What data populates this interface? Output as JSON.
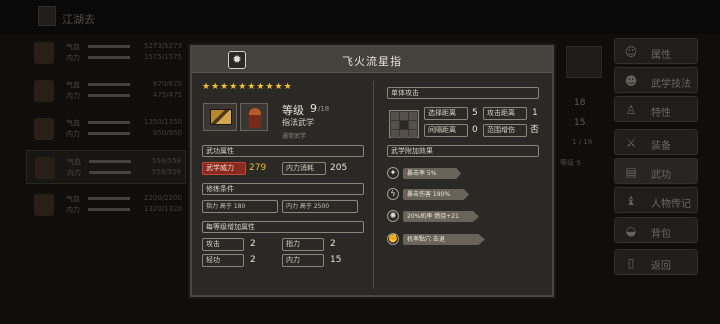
{
  "topbar": {
    "title": "江湖去"
  },
  "members": [
    {
      "label_hp": "气血",
      "label_mp": "内力",
      "hp": "5273/5273",
      "mp": "1575/1575"
    },
    {
      "label_hp": "气血",
      "label_mp": "内力",
      "hp": "670/670",
      "mp": "475/475"
    },
    {
      "label_hp": "气血",
      "label_mp": "内力",
      "hp": "1350/1350",
      "mp": "950/950"
    },
    {
      "label_hp": "气血",
      "label_mp": "内力",
      "hp": "558/558",
      "mp": "558/558"
    },
    {
      "label_hp": "气血",
      "label_mp": "内力",
      "hp": "2200/2200",
      "mp": "1320/1320"
    }
  ],
  "right_menu": [
    {
      "label": "属性",
      "icon": "person-icon"
    },
    {
      "label": "武学技法",
      "icon": "martial-icon"
    },
    {
      "label": "特性",
      "icon": "trait-icon"
    },
    {
      "label": "装备",
      "icon": "sword-icon"
    },
    {
      "label": "武功",
      "icon": "book-icon"
    },
    {
      "label": "人物传记",
      "icon": "biography-icon"
    },
    {
      "label": "背包",
      "icon": "bag-icon"
    },
    {
      "label": "返回",
      "icon": "return-icon"
    }
  ],
  "bg_panel": {
    "v1": "18",
    "v2": "15",
    "v3": "1 / 18",
    "level_text": "等级 9"
  },
  "modal": {
    "title": "飞火流星指",
    "icon": "flame-icon",
    "stars": "★★★★★★★★★★",
    "level_label": "等级",
    "level_value": "9",
    "level_max": "/18",
    "skill_type": "指法武学",
    "skill_sub": "通常武学",
    "sections": {
      "attr": "武功属性",
      "req": "修练条件",
      "per_level": "每等级增加属性",
      "attack": "单体攻击",
      "extra": "武学附加效果"
    },
    "attrs": [
      {
        "label": "武学威力",
        "value": "279"
      },
      {
        "label": "内力消耗",
        "value": "205"
      }
    ],
    "reqs": [
      {
        "label": "指力 高于 180"
      },
      {
        "label": "内力 高于 2500"
      }
    ],
    "per_level": [
      {
        "label": "攻击",
        "value": "2"
      },
      {
        "label": "指力",
        "value": "2"
      },
      {
        "label": "轻功",
        "value": "2"
      },
      {
        "label": "内力",
        "value": "15"
      }
    ],
    "attack_stats": [
      {
        "label": "选择距离",
        "value": "5"
      },
      {
        "label": "攻击距离",
        "value": "1"
      },
      {
        "label": "间隔距离",
        "value": "0"
      },
      {
        "label": "范围增伤",
        "value": "否"
      }
    ],
    "effects": [
      {
        "text": "暴击率 5%",
        "icon": "crit-icon",
        "fill": 0.5
      },
      {
        "text": "暴击伤害 190%",
        "icon": "lightning-icon",
        "fill": 0.6
      },
      {
        "text": "20%机率 燃烧+21",
        "icon": "fire-icon",
        "fill": 0.72
      },
      {
        "text": "机率點穴 击退",
        "icon": "fist-icon",
        "fill": 0.8
      }
    ]
  }
}
